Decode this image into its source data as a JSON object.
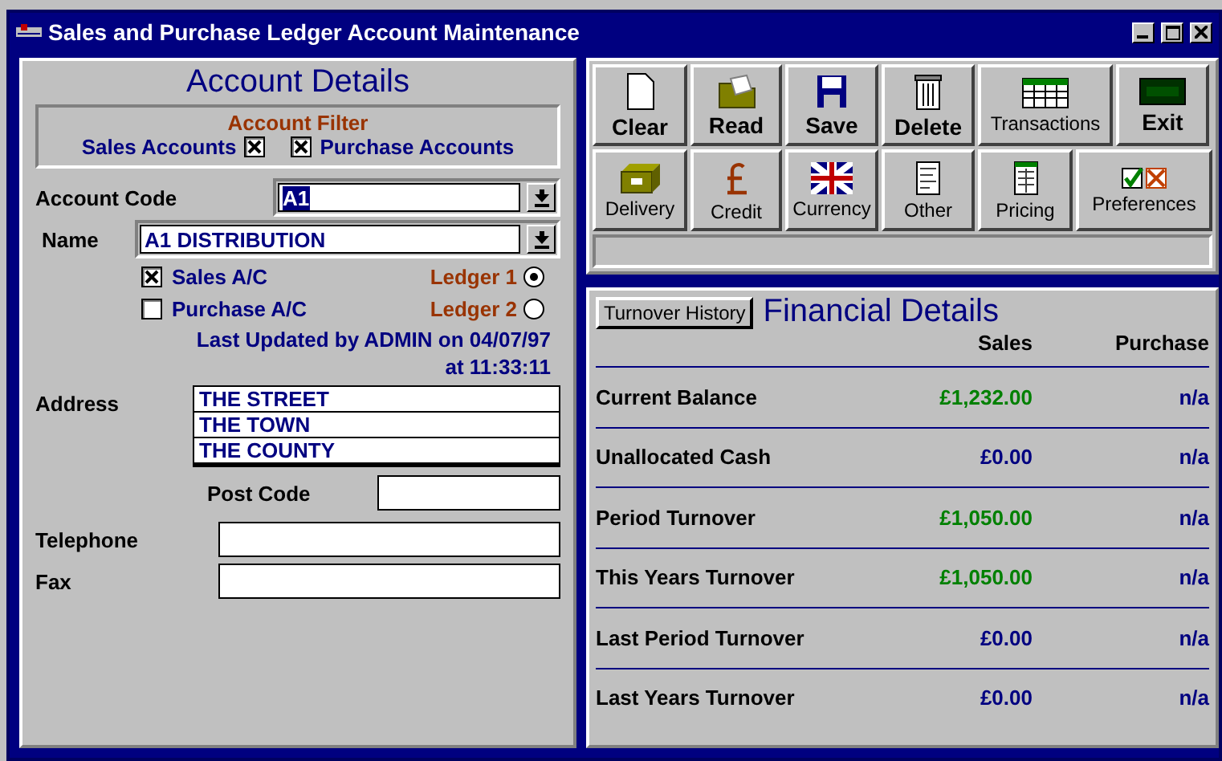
{
  "window": {
    "title": "Sales and Purchase Ledger Account Maintenance"
  },
  "account_details": {
    "heading": "Account Details",
    "filter": {
      "title": "Account Filter",
      "options": [
        {
          "label": "Sales Accounts",
          "checked": true
        },
        {
          "label": "Purchase Accounts",
          "checked": true
        }
      ]
    },
    "account_code": {
      "label": "Account Code",
      "value": "A1"
    },
    "name": {
      "label": "Name",
      "value": "A1 DISTRIBUTION"
    },
    "account_types": [
      {
        "label": "Sales A/C",
        "checked": true,
        "ledger": "Ledger 1",
        "selected": true
      },
      {
        "label": "Purchase A/C",
        "checked": false,
        "ledger": "Ledger 2",
        "selected": false
      }
    ],
    "last_updated": [
      "Last Updated by ADMIN on 04/07/97",
      "at 11:33:11"
    ],
    "address": {
      "label": "Address",
      "lines": [
        "THE STREET",
        "THE TOWN",
        "THE COUNTY"
      ]
    },
    "post_code": {
      "label": "Post Code"
    },
    "telephone": {
      "label": "Telephone"
    },
    "fax": {
      "label": "Fax"
    }
  },
  "toolbar": {
    "rows": [
      [
        {
          "label": "Clear",
          "bold": true
        },
        {
          "label": "Read",
          "bold": true
        },
        {
          "label": "Save",
          "bold": true
        },
        {
          "label": "Delete",
          "bold": true
        },
        {
          "label": "Transactions",
          "bold": false
        },
        {
          "label": "Exit",
          "bold": true
        }
      ],
      [
        {
          "label": "Delivery",
          "bold": false
        },
        {
          "label": "Credit",
          "bold": false
        },
        {
          "label": "Currency",
          "bold": false
        },
        {
          "label": "Other",
          "bold": false
        },
        {
          "label": "Pricing",
          "bold": false
        },
        {
          "label": "Preferences",
          "bold": false
        }
      ]
    ]
  },
  "financial_details": {
    "history_button": "Turnover History",
    "heading": "Financial Details",
    "columns": [
      "Sales",
      "Purchase"
    ],
    "rows": [
      {
        "label": "Current Balance",
        "sales": "£1,232.00",
        "color": "#008000",
        "purchase": "n/a"
      },
      {
        "label": "Unallocated Cash",
        "sales": "£0.00",
        "color": "#000080",
        "purchase": "n/a"
      },
      {
        "label": "Period Turnover",
        "sales": "£1,050.00",
        "color": "#008000",
        "purchase": "n/a"
      },
      {
        "label": "This Years Turnover",
        "sales": "£1,050.00",
        "color": "#008000",
        "purchase": "n/a"
      },
      {
        "label": "Last Period Turnover",
        "sales": "£0.00",
        "color": "#000080",
        "purchase": "n/a"
      },
      {
        "label": "Last Years Turnover",
        "sales": "£0.00",
        "color": "#000080",
        "purchase": "n/a"
      }
    ]
  }
}
